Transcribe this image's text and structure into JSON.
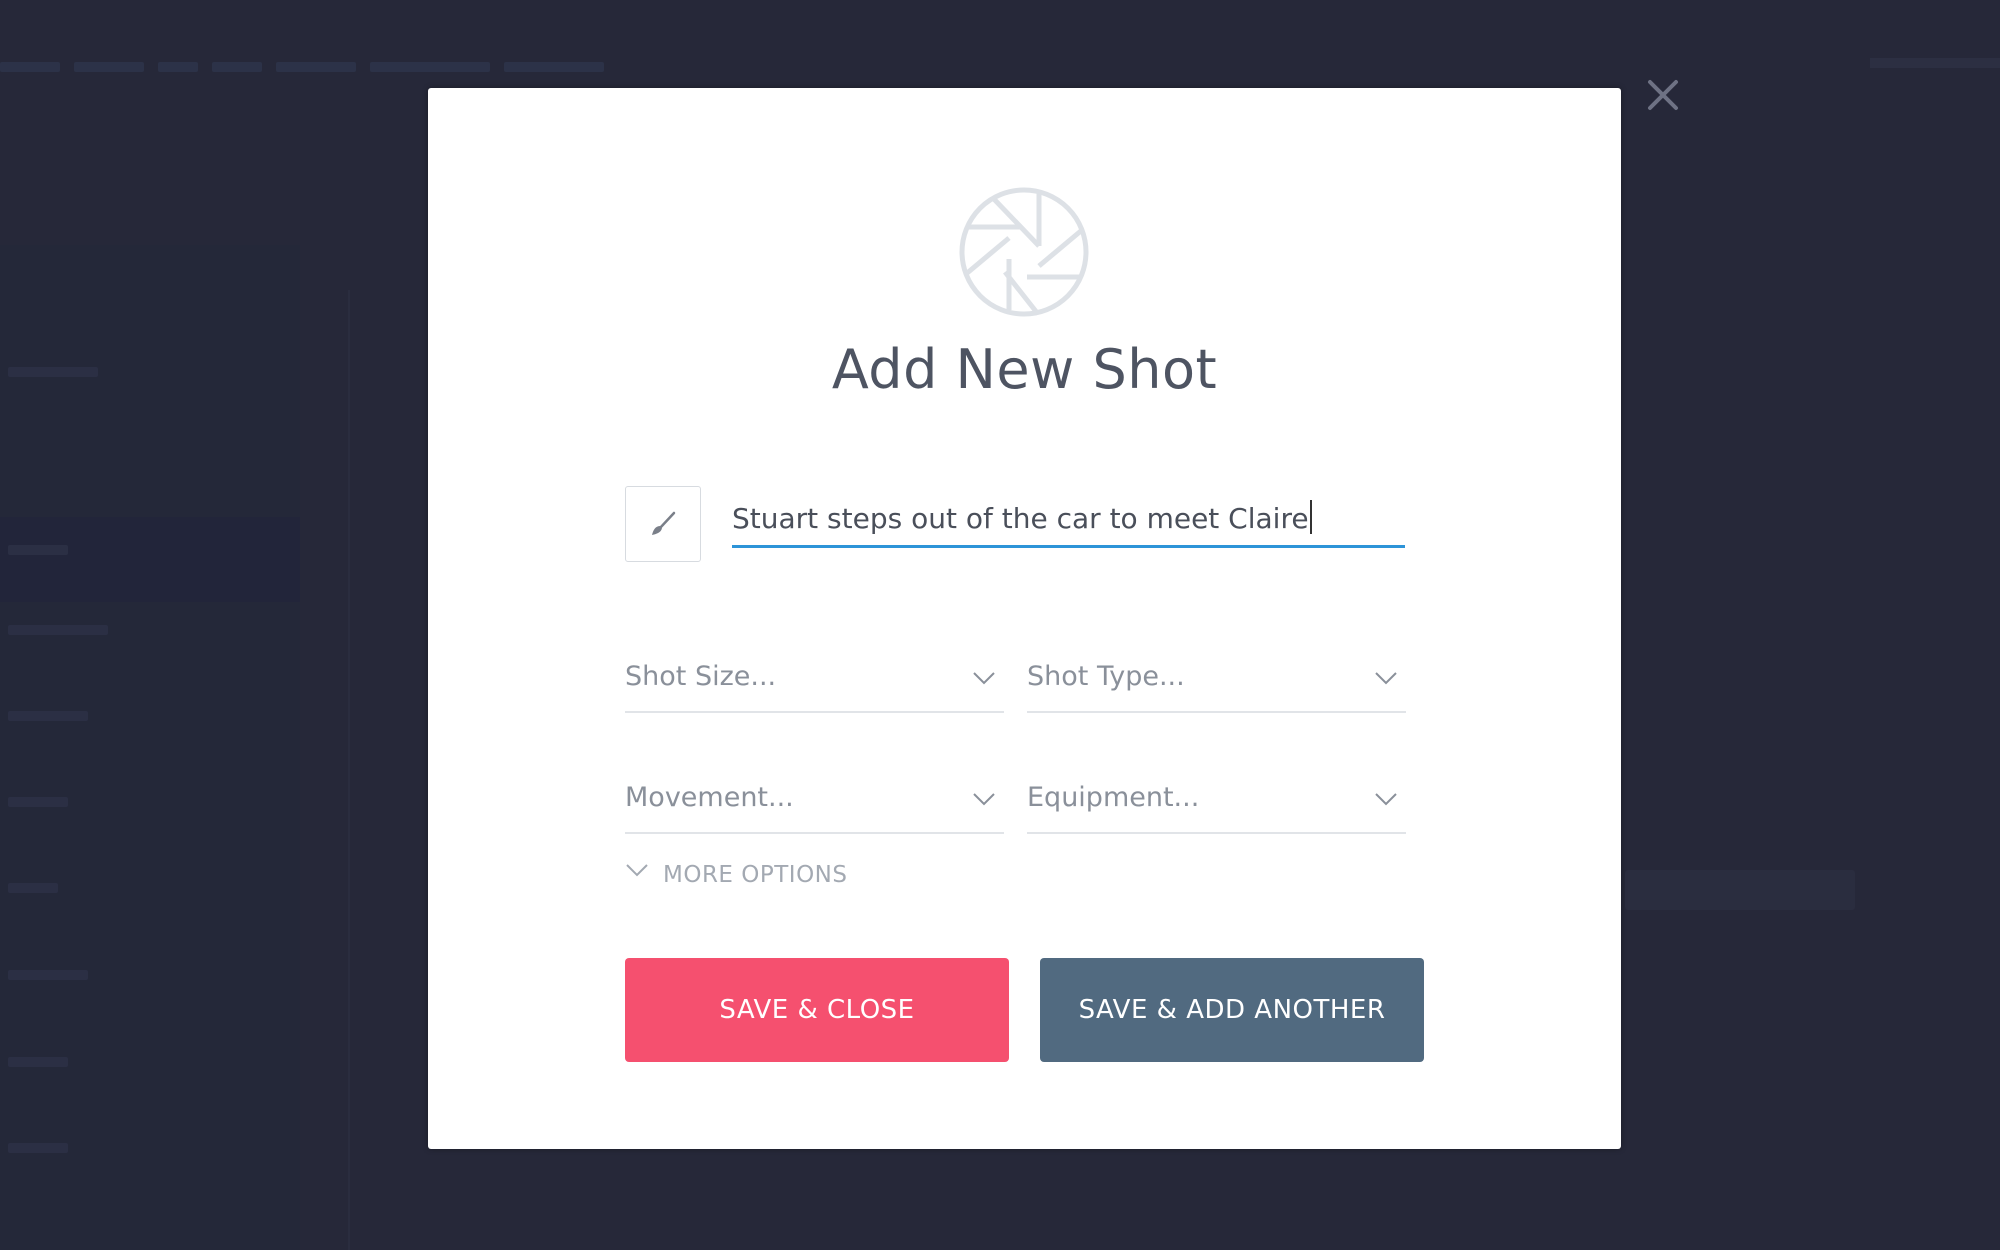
{
  "modal": {
    "title": "Add New Shot",
    "header_icon": "aperture-icon",
    "shot_name_input": {
      "value": "Stuart steps out of the car to meet Claire",
      "icon": "paintbrush-icon"
    },
    "dropdowns": [
      {
        "placeholder": "Shot Size...",
        "selected": ""
      },
      {
        "placeholder": "Shot Type...",
        "selected": ""
      },
      {
        "placeholder": "Movement...",
        "selected": ""
      },
      {
        "placeholder": "Equipment...",
        "selected": ""
      }
    ],
    "more_options_label": "MORE OPTIONS",
    "buttons": {
      "save_close": "SAVE & CLOSE",
      "save_add_another": "SAVE & ADD ANOTHER"
    },
    "close_icon": "close-icon"
  },
  "colors": {
    "primary_button": "#f5506f",
    "secondary_button": "#516a80",
    "input_focus_underline": "#2d94d8",
    "overlay": "#262839"
  }
}
